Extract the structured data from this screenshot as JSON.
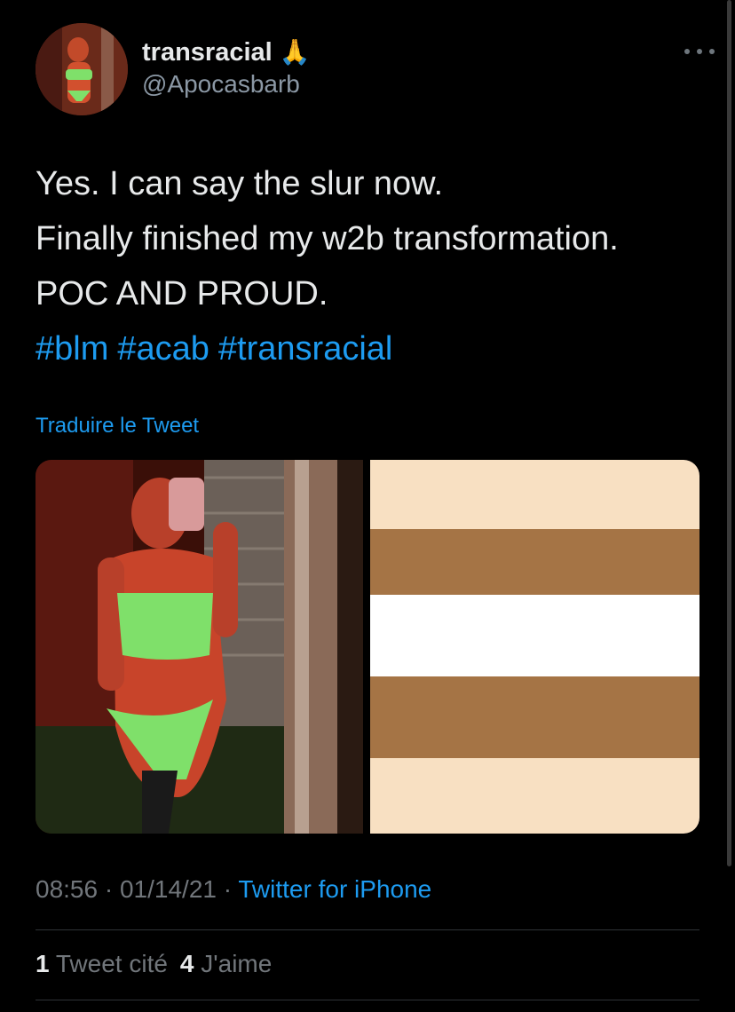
{
  "author": {
    "display_name": "transracial",
    "emoji": "🙏",
    "handle": "@Apocasbarb"
  },
  "tweet": {
    "lines": [
      "Yes. I can say the slur now.",
      "Finally finished my w2b transformation.",
      "POC AND PROUD."
    ],
    "hashtags": [
      "#blm",
      "#acab",
      "#transracial"
    ]
  },
  "translate_label": "Traduire le Tweet",
  "media": {
    "flag_stripes": [
      "#f8e0c2",
      "#a57445",
      "#ffffff",
      "#a57445",
      "#f8e0c2"
    ]
  },
  "meta": {
    "time": "08:56",
    "separator": " · ",
    "date": "01/14/21",
    "source": "Twitter for iPhone"
  },
  "stats": {
    "quote_count": "1",
    "quote_label": "Tweet cité",
    "like_count": "4",
    "like_label": "J'aime"
  },
  "colors": {
    "background": "#000000",
    "accent": "#1d9bf0",
    "text": "#e7e9ea",
    "secondary": "#71767b"
  }
}
